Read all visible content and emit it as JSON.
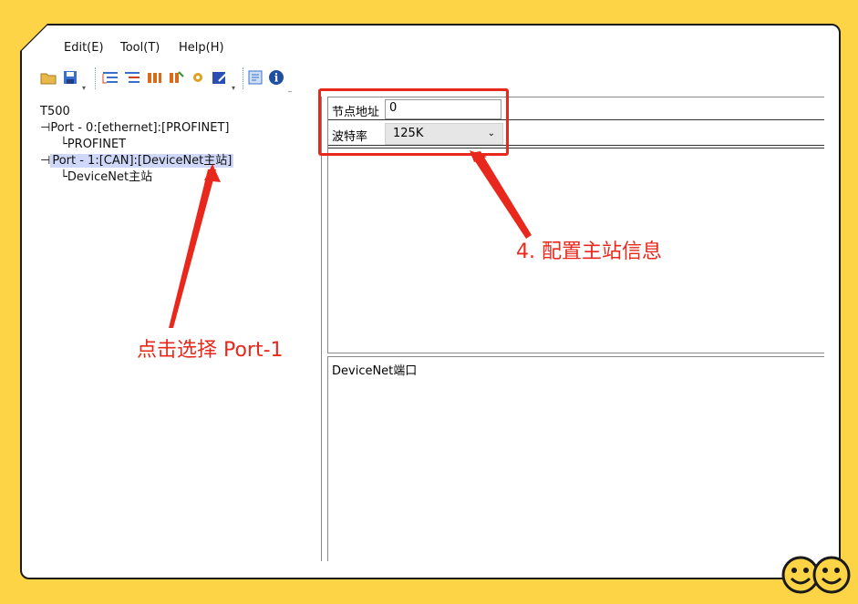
{
  "menu": {
    "edit": "Edit(E)",
    "tool": "Tool(T)",
    "help": "Help(H)"
  },
  "toolbar": {
    "icons": [
      "open-icon",
      "save-icon",
      "tree-add-icon",
      "tree-remove-icon",
      "module-add-icon",
      "module-remove-icon",
      "settings-icon",
      "edit-icon",
      "config-icon",
      "info-icon"
    ]
  },
  "tree": {
    "root": "T500",
    "port0": "Port - 0:[ethernet]:[PROFINET]",
    "port0_child": "PROFINET",
    "port1": "Port - 1:[CAN]:[DeviceNet主站]",
    "port1_child": "DeviceNet主站"
  },
  "props": {
    "node_label": "节点地址",
    "node_value": "0",
    "baud_label": "波特率",
    "baud_value": "125K"
  },
  "description": "DeviceNet端口",
  "annotations": {
    "step4": "4. 配置主站信息",
    "select": "点击选择 Port-1"
  },
  "colors": {
    "background": "#fdd446",
    "accent_red": "#e8281c",
    "selection": "#cfd8f8"
  }
}
